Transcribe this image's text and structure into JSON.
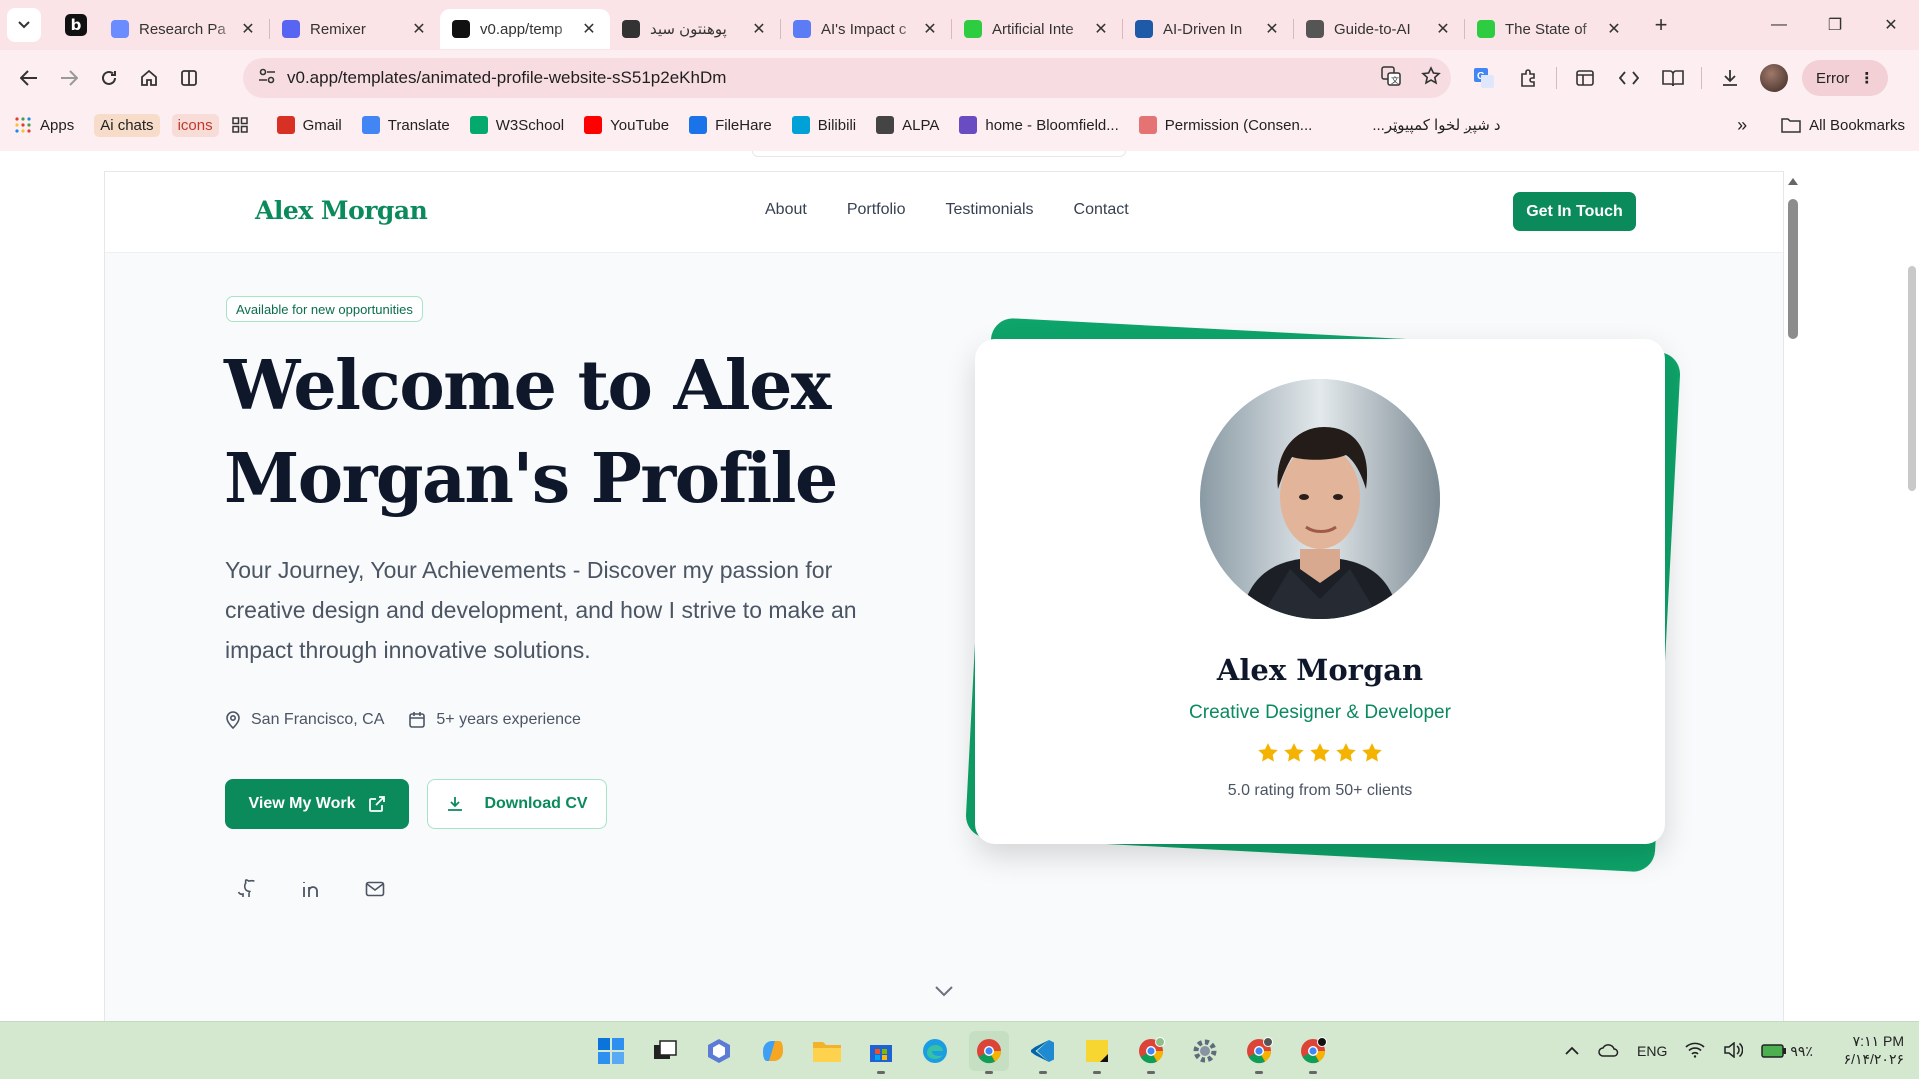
{
  "browser": {
    "tabs": [
      {
        "title": "Research Pa",
        "icon": "sparkle-icon",
        "color": "#6b8cff"
      },
      {
        "title": "Remixer",
        "icon": "discord-icon",
        "color": "#5865f2"
      },
      {
        "title": "v0.app/temp",
        "icon": "v0-icon",
        "color": "#111111",
        "active": true
      },
      {
        "title": "پوهنتون سید",
        "icon": "openai-icon",
        "color": "#333333"
      },
      {
        "title": "AI's Impact c",
        "icon": "gemini-icon",
        "color": "#5b7cf5"
      },
      {
        "title": "Artificial Inte",
        "icon": "smiley-icon",
        "color": "#2ecc40"
      },
      {
        "title": "AI-Driven In",
        "icon": "lock-icon",
        "color": "#1e5aa8"
      },
      {
        "title": "Guide-to-AI",
        "icon": "globe-icon",
        "color": "#555555"
      },
      {
        "title": "The State of",
        "icon": "smiley-icon",
        "color": "#2ecc40"
      }
    ],
    "url": "v0.app/templates/animated-profile-website-sS51p2eKhDm",
    "error_label": "Error",
    "bookmarks": [
      {
        "label": "Apps",
        "icon": "apps-grid-icon"
      },
      {
        "label": "Ai chats",
        "chip": "tan"
      },
      {
        "label": "icons",
        "chip": "red"
      },
      {
        "label": "",
        "icon": "grid-icon"
      },
      {
        "label": "Gmail",
        "icon": "gmail-icon",
        "color": "#d93025"
      },
      {
        "label": "Translate",
        "icon": "translate-icon",
        "color": "#4285f4"
      },
      {
        "label": "W3School",
        "icon": "w3-icon",
        "color": "#04aa6d"
      },
      {
        "label": "YouTube",
        "icon": "youtube-icon",
        "color": "#ff0000"
      },
      {
        "label": "FileHare",
        "icon": "filehare-icon",
        "color": "#1a73e8"
      },
      {
        "label": "Bilibili",
        "icon": "bilibili-icon",
        "color": "#00a1d6"
      },
      {
        "label": "ALPA",
        "icon": "globe-icon",
        "color": "#444444"
      },
      {
        "label": "home - Bloomfield...",
        "icon": "bloomfield-icon",
        "color": "#6a4cc2"
      },
      {
        "label": "Permission (Consen...",
        "icon": "doc-icon",
        "color": "#e57373"
      },
      {
        "label": "د شپږ لخوا کمپیوټر...",
        "icon": "",
        "color": ""
      }
    ],
    "all_bookmarks_label": "All Bookmarks"
  },
  "site": {
    "logo": "Alex Morgan",
    "nav": [
      "About",
      "Portfolio",
      "Testimonials",
      "Contact"
    ],
    "cta": "Get In Touch",
    "badge": "Available for new opportunities",
    "hero_title": "Welcome to Alex Morgan's Profile",
    "hero_subtitle": "Your Journey, Your Achievements - Discover my passion for creative design and development, and how I strive to make an impact through innovative solutions.",
    "location": "San Francisco, CA",
    "experience": "5+ years experience",
    "primary_button": "View My Work",
    "secondary_button": "Download CV",
    "socials": [
      "github-icon",
      "linkedin-icon",
      "mail-icon"
    ],
    "card": {
      "name": "Alex Morgan",
      "role": "Creative Designer & Developer",
      "stars": 5,
      "rating_text": "5.0 rating from 50+ clients"
    },
    "accent": "#0b8a5c"
  },
  "taskbar": {
    "language": "ENG",
    "battery": "۹۹٪",
    "time": "۷:۱۱ PM",
    "date": "۶/۱۴/۲۰۲۶"
  }
}
